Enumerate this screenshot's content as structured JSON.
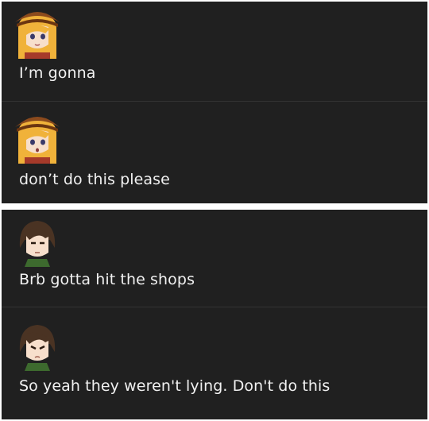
{
  "conversation": {
    "top": [
      {
        "speaker": "blonde-girl-with-hat",
        "text": "I’m gonna"
      },
      {
        "speaker": "blonde-girl-with-hat",
        "text": "don’t do this please"
      }
    ],
    "bottom": [
      {
        "speaker": "brown-haired-boy",
        "text": "Brb gotta hit the shops"
      },
      {
        "speaker": "brown-haired-boy",
        "text": "So yeah they weren't lying. Don't do this"
      }
    ]
  },
  "colors": {
    "background": "#202020",
    "text": "#f1f1f1",
    "divider": "#333333",
    "blonde_hair": "#f0b23a",
    "hat": "#8b4a1d",
    "brown_hair": "#4a3323",
    "skin": "#f7dfcc"
  }
}
